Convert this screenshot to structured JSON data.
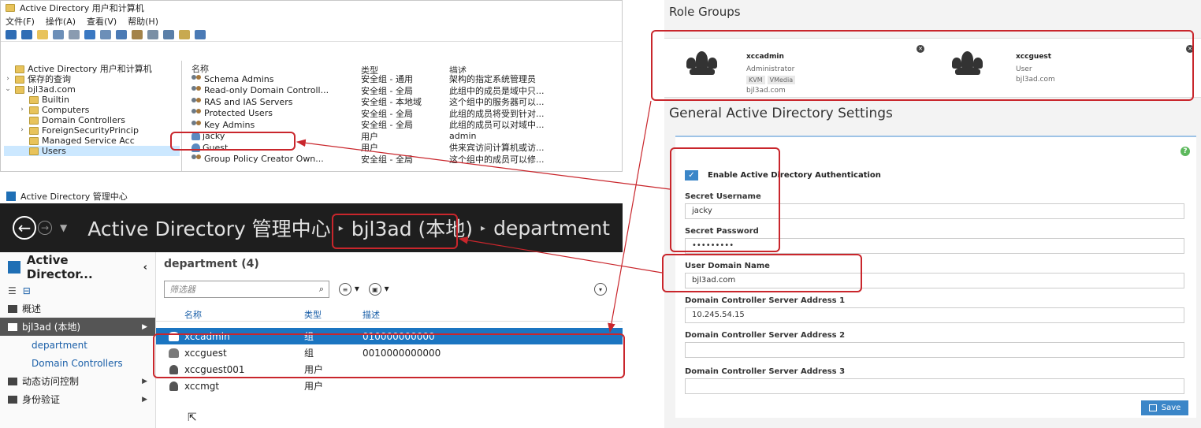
{
  "aduc": {
    "title": "Active Directory 用户和计算机",
    "menu": [
      "文件(F)",
      "操作(A)",
      "查看(V)",
      "帮助(H)"
    ],
    "tree": [
      {
        "label": "Active Directory 用户和计算机",
        "exp": "",
        "indent": 0
      },
      {
        "label": "保存的查询",
        "exp": ">",
        "indent": 0
      },
      {
        "label": "bjl3ad.com",
        "exp": "v",
        "indent": 0
      },
      {
        "label": "Builtin",
        "exp": "",
        "indent": 1
      },
      {
        "label": "Computers",
        "exp": ">",
        "indent": 1
      },
      {
        "label": "Domain Controllers",
        "exp": "",
        "indent": 1
      },
      {
        "label": "ForeignSecurityPrincip",
        "exp": ">",
        "indent": 1
      },
      {
        "label": "Managed Service Acc",
        "exp": "",
        "indent": 1
      },
      {
        "label": "Users",
        "exp": "",
        "indent": 1
      }
    ],
    "columns": [
      "名称",
      "类型",
      "描述"
    ],
    "rows": [
      {
        "name": "Schema Admins",
        "type": "安全组 - 通用",
        "desc": "架构的指定系统管理员",
        "kind": "group"
      },
      {
        "name": "Read-only Domain Controll...",
        "type": "安全组 - 全局",
        "desc": "此组中的成员是域中只...",
        "kind": "group"
      },
      {
        "name": "RAS and IAS Servers",
        "type": "安全组 - 本地域",
        "desc": "这个组中的服务器可以...",
        "kind": "group"
      },
      {
        "name": "Protected Users",
        "type": "安全组 - 全局",
        "desc": "此组的成员将受到针对...",
        "kind": "group"
      },
      {
        "name": "Key Admins",
        "type": "安全组 - 全局",
        "desc": "此组的成员可以对域中...",
        "kind": "group"
      },
      {
        "name": "jacky",
        "type": "用户",
        "desc": "admin",
        "kind": "user"
      },
      {
        "name": "Guest",
        "type": "用户",
        "desc": "供来宾访问计算机或访...",
        "kind": "user"
      },
      {
        "name": "Group Policy Creator Own...",
        "type": "安全组 - 全局",
        "desc": "这个组中的成员可以修...",
        "kind": "group"
      }
    ]
  },
  "adac": {
    "window_title": "Active Directory 管理中心",
    "breadcrumb": [
      "Active Directory 管理中心",
      "bjl3ad (本地)",
      "department"
    ],
    "side_title": "Active Director...",
    "side_items": [
      {
        "label": "概述",
        "cls": ""
      },
      {
        "label": "bjl3ad (本地)",
        "cls": "sel"
      },
      {
        "label": "department",
        "cls": "sub"
      },
      {
        "label": "Domain Controllers",
        "cls": "sub"
      },
      {
        "label": "动态访问控制",
        "cls": ""
      },
      {
        "label": "身份验证",
        "cls": ""
      }
    ],
    "main_title": "department  (4)",
    "filter_placeholder": "筛选器",
    "columns": [
      "名称",
      "类型",
      "描述"
    ],
    "rows": [
      {
        "name": "xccadmin",
        "type": "组",
        "desc": "010000000000",
        "sel": true,
        "kind": "group"
      },
      {
        "name": "xccguest",
        "type": "组",
        "desc": "0010000000000",
        "sel": false,
        "kind": "group"
      },
      {
        "name": "xccguest001",
        "type": "用户",
        "desc": "",
        "sel": false,
        "kind": "user"
      },
      {
        "name": "xccmgt",
        "type": "用户",
        "desc": "",
        "sel": false,
        "kind": "user"
      }
    ]
  },
  "right": {
    "role_groups_title": "Role Groups",
    "role_groups": [
      {
        "name": "xccadmin",
        "role": "Administrator",
        "tags": [
          "KVM",
          "VMedia"
        ],
        "domain": "bjl3ad.com"
      },
      {
        "name": "xccguest",
        "role": "User",
        "tags": [],
        "domain": "bjl3ad.com"
      }
    ],
    "settings_title": "General Active Directory Settings",
    "enable_label": "Enable Active Directory Authentication",
    "fields": [
      {
        "label": "Secret Username",
        "value": "jacky"
      },
      {
        "label": "Secret Password",
        "value": "•••••••••"
      },
      {
        "label": "User Domain Name",
        "value": "bjl3ad.com"
      },
      {
        "label": "Domain Controller Server Address 1",
        "value": "10.245.54.15"
      },
      {
        "label": "Domain Controller Server Address 2",
        "value": ""
      },
      {
        "label": "Domain Controller Server Address 3",
        "value": ""
      }
    ],
    "save_label": "Save",
    "help_glyph": "?"
  },
  "colors": {
    "highlight": "#c9262c",
    "accent": "#3b86c8",
    "selection": "#1b75c1"
  }
}
